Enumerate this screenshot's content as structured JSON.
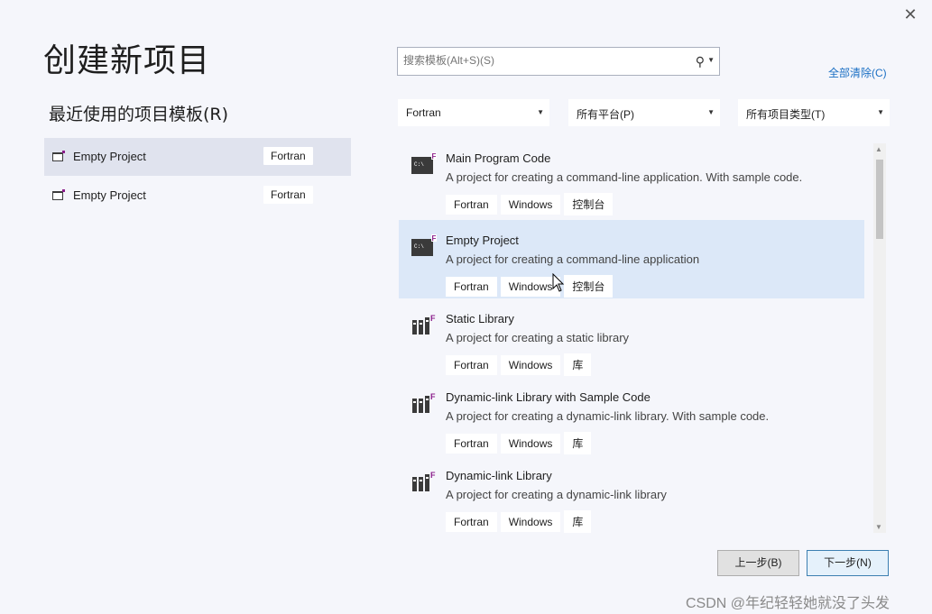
{
  "window": {
    "close_glyph": "✕"
  },
  "page_title": "创建新项目",
  "recent": {
    "title": "最近使用的项目模板(R)",
    "items": [
      {
        "name": "Empty Project",
        "tag": "Fortran",
        "selected": true
      },
      {
        "name": "Empty Project",
        "tag": "Fortran",
        "selected": false
      }
    ]
  },
  "search": {
    "placeholder": "搜索模板(Alt+S)(S)",
    "icon": "search-icon"
  },
  "clear_all": "全部清除(C)",
  "filters": {
    "language": "Fortran",
    "platform": "所有平台(P)",
    "project_type": "所有项目类型(T)"
  },
  "templates": [
    {
      "name": "Main Program Code",
      "desc": "A project for creating a command-line application. With sample code.",
      "tags": [
        "Fortran",
        "Windows",
        "控制台"
      ],
      "icon": "console-icon",
      "selected": false
    },
    {
      "name": "Empty Project",
      "desc": "A project for creating a command-line application",
      "tags": [
        "Fortran",
        "Windows",
        "控制台"
      ],
      "icon": "console-icon",
      "selected": true
    },
    {
      "name": "Static Library",
      "desc": "A project for creating a static library",
      "tags": [
        "Fortran",
        "Windows",
        "库"
      ],
      "icon": "library-icon",
      "selected": false
    },
    {
      "name": "Dynamic-link Library with Sample Code",
      "desc": "A project for creating a dynamic-link library. With sample code.",
      "tags": [
        "Fortran",
        "Windows",
        "库"
      ],
      "icon": "library-icon",
      "selected": false
    },
    {
      "name": "Dynamic-link Library",
      "desc": "A project for creating a dynamic-link library",
      "tags": [
        "Fortran",
        "Windows",
        "库"
      ],
      "icon": "library-icon",
      "selected": false
    }
  ],
  "buttons": {
    "back": "上一步(B)",
    "next": "下一步(N)"
  },
  "watermark": "CSDN @年纪轻轻她就没了头发",
  "colors": {
    "accent": "#1a6fc4",
    "selected_row": "#dce8f8",
    "fortran_badge": "#8b1e8b"
  }
}
